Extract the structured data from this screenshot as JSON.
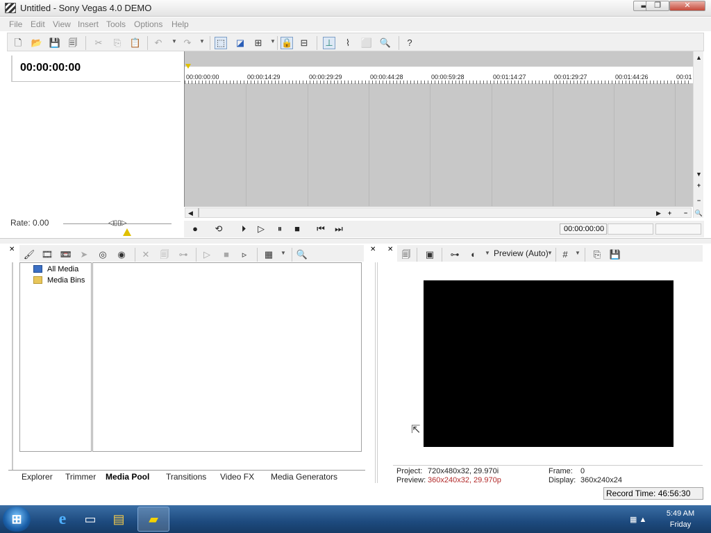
{
  "window": {
    "title": "Untitled - Sony Vegas 4.0 DEMO",
    "minimize_glyph": "▬",
    "restore_glyph": "❐",
    "close_glyph": "✕"
  },
  "menu": [
    "File",
    "Edit",
    "View",
    "Insert",
    "Tools",
    "Options",
    "Help"
  ],
  "toolbar": {
    "icons": [
      "new-icon",
      "open-icon",
      "save-icon",
      "properties-icon",
      "cut-icon",
      "copy-icon",
      "paste-icon",
      "undo-icon",
      "redo-icon",
      "normal-edit-tool-icon",
      "envelope-tool-icon",
      "selection-tool-icon",
      "ignore-grouping-icon",
      "auto-ripple-icon",
      "snapping-icon",
      "markers-icon",
      "edit-region-icon",
      "zoom-tool-icon",
      "help-icon"
    ]
  },
  "track_list": {
    "timecode": "00:00:00:00",
    "rate_label": "Rate: 0.00"
  },
  "timeline": {
    "ruler_labels": [
      "00:00:00:00",
      "00:00:14:29",
      "00:00:29:29",
      "00:00:44:28",
      "00:00:59:28",
      "00:01:14:27",
      "00:01:29:27",
      "00:01:44:26",
      "00:01"
    ]
  },
  "transport": {
    "time": "00:00:00:00"
  },
  "media_pool": {
    "tree": [
      "All Media",
      "Media Bins"
    ],
    "tabs": [
      "Explorer",
      "Trimmer",
      "Media Pool",
      "Transitions",
      "Video FX",
      "Media Generators"
    ],
    "selected_tab": "Media Pool"
  },
  "preview": {
    "mode": "Preview (Auto)",
    "project_label": "Project:",
    "project_value": "720x480x32, 29.970i",
    "preview_label": "Preview:",
    "preview_value": "360x240x32, 29.970p",
    "frame_label": "Frame:",
    "frame_value": "0",
    "display_label": "Display:",
    "display_value": "360x240x24"
  },
  "status": {
    "record_time": "Record Time: 46:56:30"
  },
  "taskbar": {
    "time": "5:49 AM",
    "day": "Friday"
  },
  "colors": {
    "timeline_bg": "#c8c8c8",
    "preview_bg": "#000000",
    "taskbar": "#1d4a7e",
    "accent_red": "#b22a2a"
  }
}
